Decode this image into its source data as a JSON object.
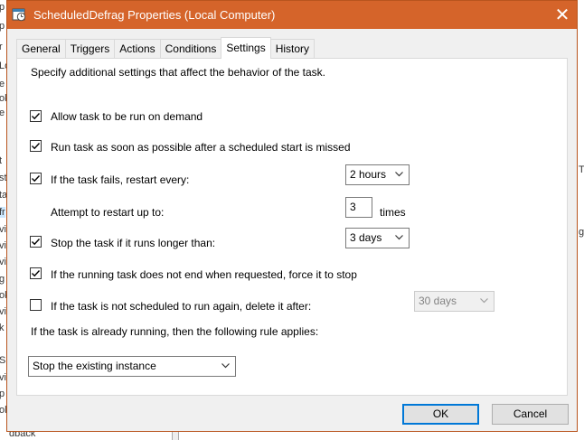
{
  "window": {
    "title": "ScheduledDefrag Properties (Local Computer)",
    "close_glyph": "✕",
    "accent_color": "#d5642a"
  },
  "tabs": [
    {
      "label": "General",
      "active": false
    },
    {
      "label": "Triggers",
      "active": false
    },
    {
      "label": "Actions",
      "active": false
    },
    {
      "label": "Conditions",
      "active": false
    },
    {
      "label": "Settings",
      "active": true
    },
    {
      "label": "History",
      "active": false
    }
  ],
  "settings": {
    "intro": "Specify additional settings that affect the behavior of the task.",
    "allow_on_demand": {
      "label": "Allow task to be run on demand",
      "checked": true
    },
    "run_asap": {
      "label": "Run task as soon as possible after a scheduled start is missed",
      "checked": true
    },
    "restart_on_fail": {
      "label": "If the task fails, restart every:",
      "checked": true,
      "interval": "2 hours"
    },
    "restart_attempts": {
      "label": "Attempt to restart up to:",
      "value": "3",
      "suffix": "times"
    },
    "stop_if_longer": {
      "label": "Stop the task if it runs longer than:",
      "checked": true,
      "duration": "3 days"
    },
    "force_stop": {
      "label": "If the running task does not end when requested, force it to stop",
      "checked": true
    },
    "delete_if_not_scheduled": {
      "label": "If the task is not scheduled to run again, delete it after:",
      "checked": false,
      "after": "30 days"
    },
    "rule_label": "If the task is already running, then the following rule applies:",
    "rule_value": "Stop the existing instance"
  },
  "buttons": {
    "ok": "OK",
    "cancel": "Cancel"
  },
  "background": {
    "left_fragments": [
      "p",
      "p",
      "r",
      "Lo",
      "e",
      "ok",
      "e",
      "t",
      "st",
      "ta",
      "fr",
      "vi",
      "vi",
      "vi",
      "g",
      "ok",
      "vi",
      "k",
      "S",
      "vi",
      "p",
      "ol"
    ],
    "right_fragments": [
      "T",
      "g"
    ],
    "bottom_fragment": "dback"
  }
}
